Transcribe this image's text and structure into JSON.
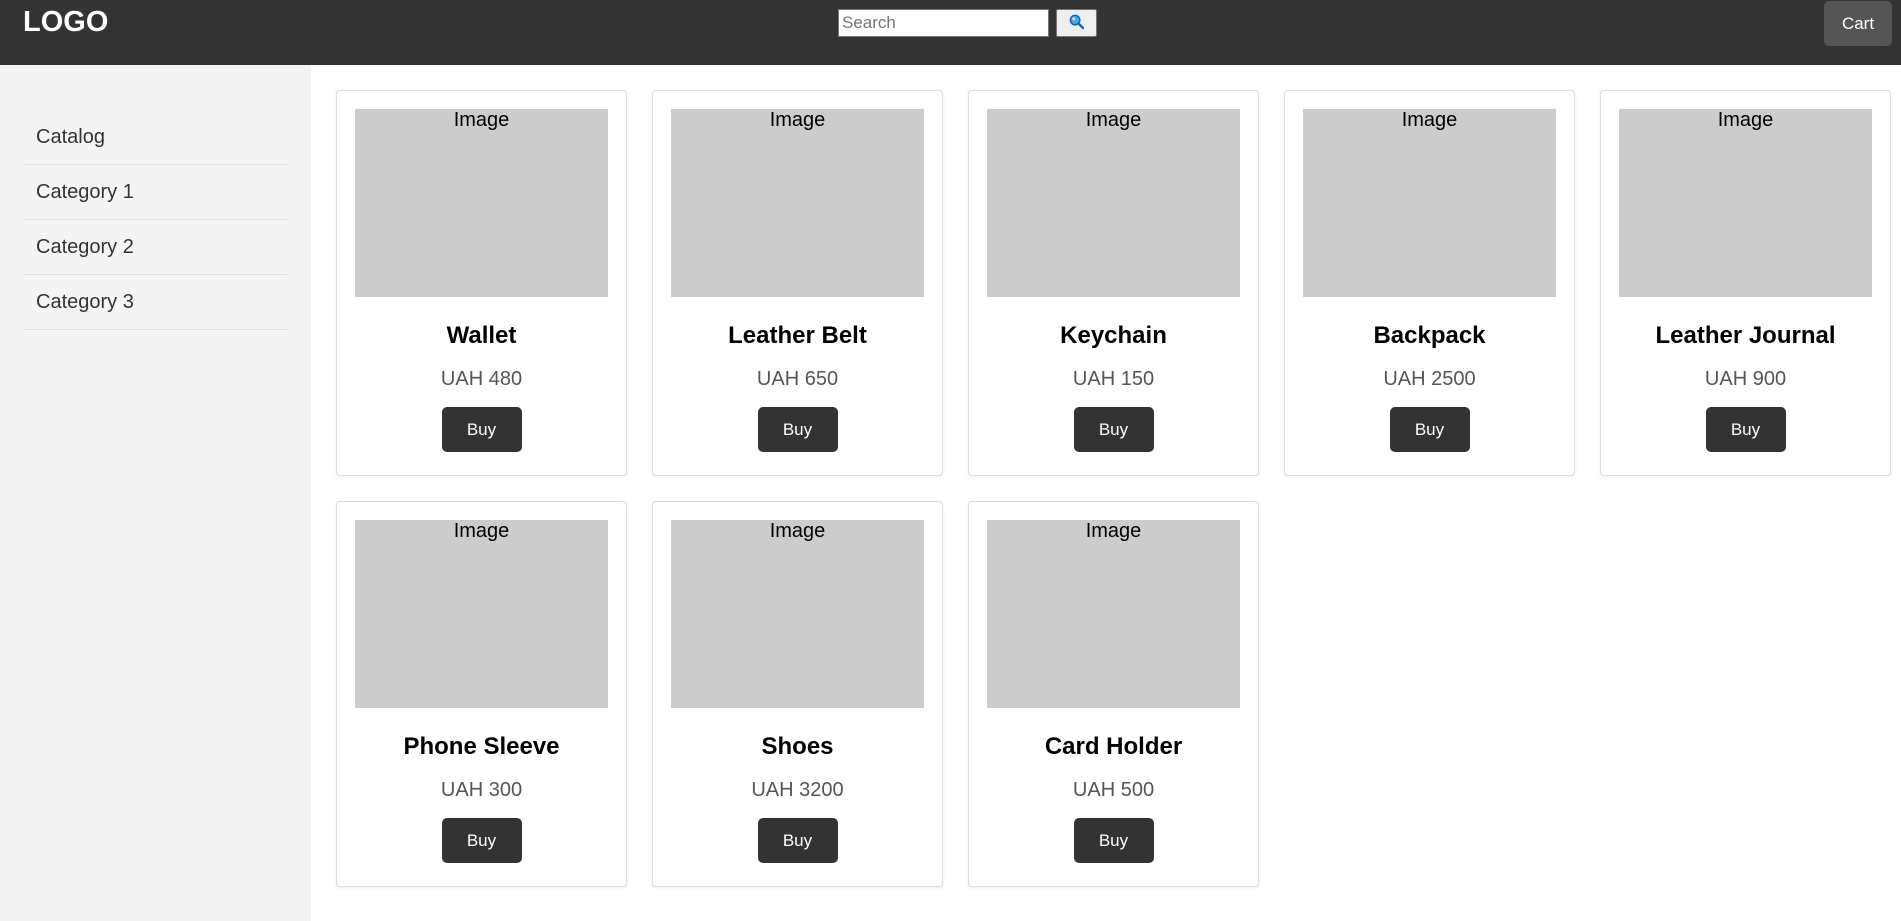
{
  "header": {
    "logo": "LOGO",
    "search_placeholder": "Search",
    "search_icon": "search-icon",
    "cart_label": "Cart"
  },
  "sidebar": {
    "items": [
      {
        "label": "Catalog"
      },
      {
        "label": "Category 1"
      },
      {
        "label": "Category 2"
      },
      {
        "label": "Category 3"
      }
    ]
  },
  "products": [
    {
      "image_label": "Image",
      "name": "Wallet",
      "price": "UAH 480",
      "buy_label": "Buy"
    },
    {
      "image_label": "Image",
      "name": "Leather Belt",
      "price": "UAH 650",
      "buy_label": "Buy"
    },
    {
      "image_label": "Image",
      "name": "Keychain",
      "price": "UAH 150",
      "buy_label": "Buy"
    },
    {
      "image_label": "Image",
      "name": "Backpack",
      "price": "UAH 2500",
      "buy_label": "Buy"
    },
    {
      "image_label": "Image",
      "name": "Leather Journal",
      "price": "UAH 900",
      "buy_label": "Buy"
    },
    {
      "image_label": "Image",
      "name": "Phone Sleeve",
      "price": "UAH 300",
      "buy_label": "Buy"
    },
    {
      "image_label": "Image",
      "name": "Shoes",
      "price": "UAH 3200",
      "buy_label": "Buy"
    },
    {
      "image_label": "Image",
      "name": "Card Holder",
      "price": "UAH 500",
      "buy_label": "Buy"
    }
  ],
  "colors": {
    "header_bg": "#333333",
    "sidebar_bg": "#f4f4f4",
    "image_placeholder": "#cccccc",
    "button_bg": "#333333",
    "cart_bg": "#555555",
    "search_icon_color": "#1e90ff"
  }
}
